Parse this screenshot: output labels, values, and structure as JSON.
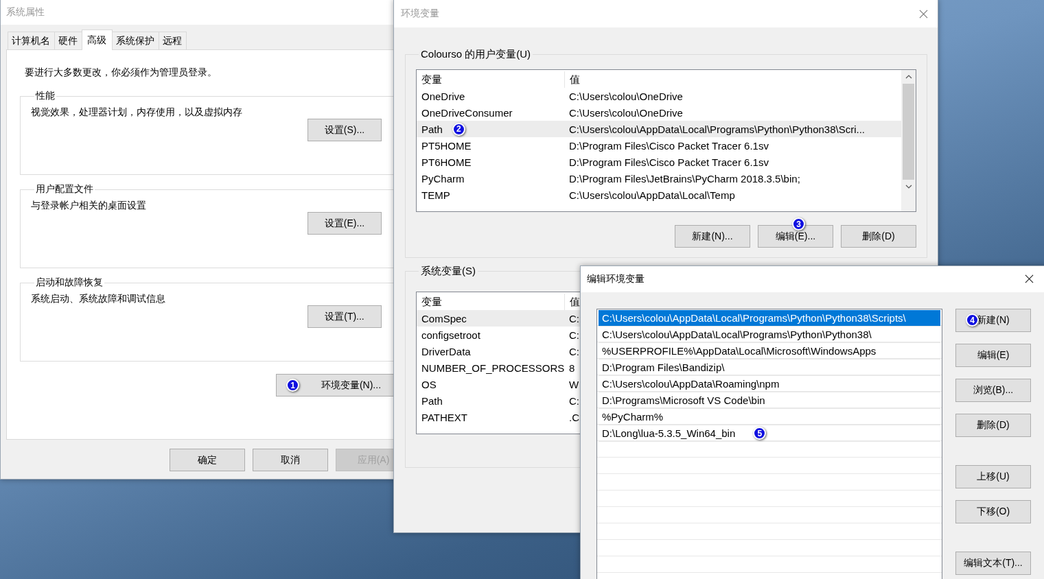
{
  "system_properties": {
    "title": "系统属性",
    "tabs": [
      {
        "label": "计算机名",
        "selected": false
      },
      {
        "label": "硬件",
        "selected": false
      },
      {
        "label": "高级",
        "selected": true
      },
      {
        "label": "系统保护",
        "selected": false
      },
      {
        "label": "远程",
        "selected": false
      }
    ],
    "notice": "要进行大多数更改，你必须作为管理员登录。",
    "groups": [
      {
        "legend": "性能",
        "description": "视觉效果，处理器计划，内存使用，以及虚拟内存",
        "button": "设置(S)..."
      },
      {
        "legend": "用户配置文件",
        "description": "与登录帐户相关的桌面设置",
        "button": "设置(E)..."
      },
      {
        "legend": "启动和故障恢复",
        "description": "系统启动、系统故障和调试信息",
        "button": "设置(T)..."
      }
    ],
    "env_button": {
      "label": "环境变量(N)...",
      "callout": "1"
    },
    "buttons": [
      {
        "label": "确定",
        "disabled": false
      },
      {
        "label": "取消",
        "disabled": false
      },
      {
        "label": "应用(A)",
        "disabled": true
      }
    ]
  },
  "environment_variables": {
    "title": "环境变量",
    "user_group": {
      "legend": "Colourso 的用户变量(U)",
      "columns": [
        "变量",
        "值"
      ],
      "rows": [
        {
          "name": "OneDrive",
          "value": "C:\\Users\\colou\\OneDrive",
          "selected": false
        },
        {
          "name": "OneDriveConsumer",
          "value": "C:\\Users\\colou\\OneDrive",
          "selected": false
        },
        {
          "name": "Path",
          "value": "C:\\Users\\colou\\AppData\\Local\\Programs\\Python\\Python38\\Scri...",
          "selected": true,
          "callout": "2"
        },
        {
          "name": "PT5HOME",
          "value": "D:\\Program Files\\Cisco Packet Tracer 6.1sv",
          "selected": false
        },
        {
          "name": "PT6HOME",
          "value": "D:\\Program Files\\Cisco Packet Tracer 6.1sv",
          "selected": false
        },
        {
          "name": "PyCharm",
          "value": "D:\\Program Files\\JetBrains\\PyCharm 2018.3.5\\bin;",
          "selected": false
        },
        {
          "name": "TEMP",
          "value": "C:\\Users\\colou\\AppData\\Local\\Temp",
          "selected": false
        }
      ],
      "buttons": [
        {
          "label": "新建(N)..."
        },
        {
          "label": "编辑(E)...",
          "callout": "3"
        },
        {
          "label": "删除(D)"
        }
      ]
    },
    "system_group": {
      "legend": "系统变量(S)",
      "columns": [
        "变量",
        "值"
      ],
      "rows": [
        {
          "name": "ComSpec",
          "value": "C:",
          "selected": true
        },
        {
          "name": "configsetroot",
          "value": "C:",
          "selected": false
        },
        {
          "name": "DriverData",
          "value": "C:",
          "selected": false
        },
        {
          "name": "NUMBER_OF_PROCESSORS",
          "value": "8",
          "selected": false
        },
        {
          "name": "OS",
          "value": "W",
          "selected": false
        },
        {
          "name": "Path",
          "value": "C:",
          "selected": false
        },
        {
          "name": "PATHEXT",
          "value": ".C",
          "selected": false
        }
      ]
    }
  },
  "edit_variable": {
    "title": "编辑环境变量",
    "entries": [
      {
        "text": "C:\\Users\\colou\\AppData\\Local\\Programs\\Python\\Python38\\Scripts\\",
        "selected": true
      },
      {
        "text": "C:\\Users\\colou\\AppData\\Local\\Programs\\Python\\Python38\\",
        "selected": false
      },
      {
        "text": "%USERPROFILE%\\AppData\\Local\\Microsoft\\WindowsApps",
        "selected": false
      },
      {
        "text": "D:\\Program Files\\Bandizip\\",
        "selected": false
      },
      {
        "text": "C:\\Users\\colou\\AppData\\Roaming\\npm",
        "selected": false
      },
      {
        "text": "D:\\Programs\\Microsoft VS Code\\bin",
        "selected": false
      },
      {
        "text": "%PyCharm%",
        "selected": false
      },
      {
        "text": "D:\\Long\\lua-5.3.5_Win64_bin",
        "selected": false,
        "callout": "5"
      }
    ],
    "buttons": [
      {
        "label": "新建(N)",
        "callout": "4"
      },
      {
        "label": "编辑(E)"
      },
      {
        "label": "浏览(B)..."
      },
      {
        "label": "删除(D)"
      },
      {
        "label": "上移(U)"
      },
      {
        "label": "下移(O)"
      },
      {
        "label": "编辑文本(T)..."
      }
    ]
  }
}
